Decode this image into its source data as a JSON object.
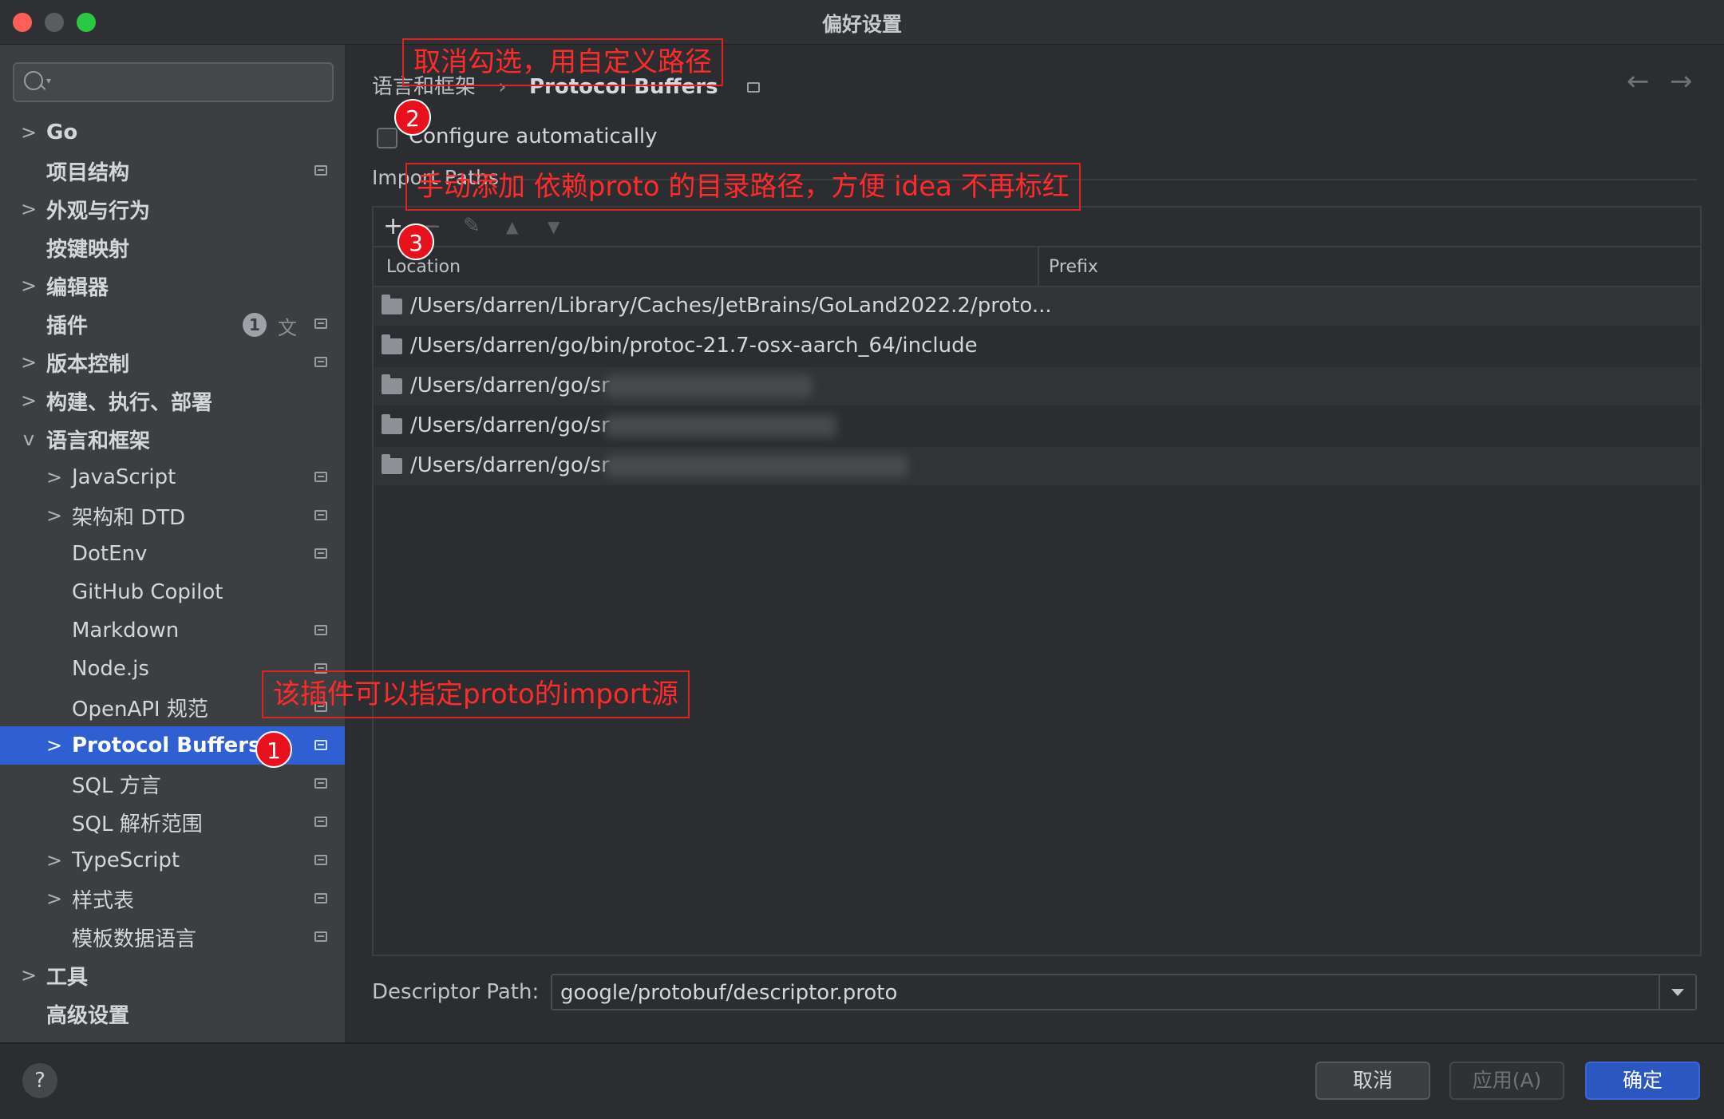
{
  "window": {
    "title": "偏好设置"
  },
  "sidebar": {
    "items": [
      {
        "label": "Go",
        "chevron": ">"
      },
      {
        "label": "项目结构"
      },
      {
        "label": "外观与行为",
        "chevron": ">"
      },
      {
        "label": "按键映射"
      },
      {
        "label": "编辑器",
        "chevron": ">"
      },
      {
        "label": "插件",
        "badge": "1"
      },
      {
        "label": "版本控制",
        "chevron": ">"
      },
      {
        "label": "构建、执行、部署",
        "chevron": ">"
      },
      {
        "label": "语言和框架",
        "chevron": "v"
      },
      {
        "label": "JavaScript",
        "chevron": ">"
      },
      {
        "label": "架构和 DTD",
        "chevron": ">"
      },
      {
        "label": "DotEnv"
      },
      {
        "label": "GitHub Copilot"
      },
      {
        "label": "Markdown"
      },
      {
        "label": "Node.js"
      },
      {
        "label": "OpenAPI 规范"
      },
      {
        "label": "Protocol Buffers",
        "chevron": ">"
      },
      {
        "label": "SQL 方言"
      },
      {
        "label": "SQL 解析范围"
      },
      {
        "label": "TypeScript",
        "chevron": ">"
      },
      {
        "label": "样式表",
        "chevron": ">"
      },
      {
        "label": "模板数据语言"
      },
      {
        "label": "工具",
        "chevron": ">"
      },
      {
        "label": "高级设置"
      }
    ]
  },
  "main": {
    "breadcrumb": {
      "parent": "语言和框架",
      "separator": "›",
      "current": "Protocol Buffers"
    },
    "nav": {
      "back": "←",
      "forward": "→"
    },
    "configure_auto_label": "Configure automatically",
    "import_paths_title": "Import Paths",
    "toolbar": {
      "add": "+",
      "remove": "−",
      "edit": "✎",
      "up": "▲",
      "down": "▼"
    },
    "table": {
      "columns": [
        "Location",
        "Prefix"
      ],
      "rows": [
        "/Users/darren/Library/Caches/JetBrains/GoLand2022.2/proto...",
        "/Users/darren/go/bin/protoc-21.7-osx-aarch_64/include",
        "/Users/darren/go/sr",
        "/Users/darren/go/sr",
        "/Users/darren/go/sr"
      ]
    },
    "descriptor": {
      "label": "Descriptor Path:",
      "value": "google/protobuf/descriptor.proto"
    }
  },
  "footer": {
    "help": "?",
    "cancel": "取消",
    "apply": "应用(A)",
    "ok": "确定"
  },
  "annotations": {
    "box1": "取消勾选，用自定义路径",
    "box2": "手动添加 依赖proto 的目录路径，方便 idea 不再标红",
    "box3": "该插件可以指定proto的import源",
    "n1": "1",
    "n2": "2",
    "n3": "3"
  }
}
